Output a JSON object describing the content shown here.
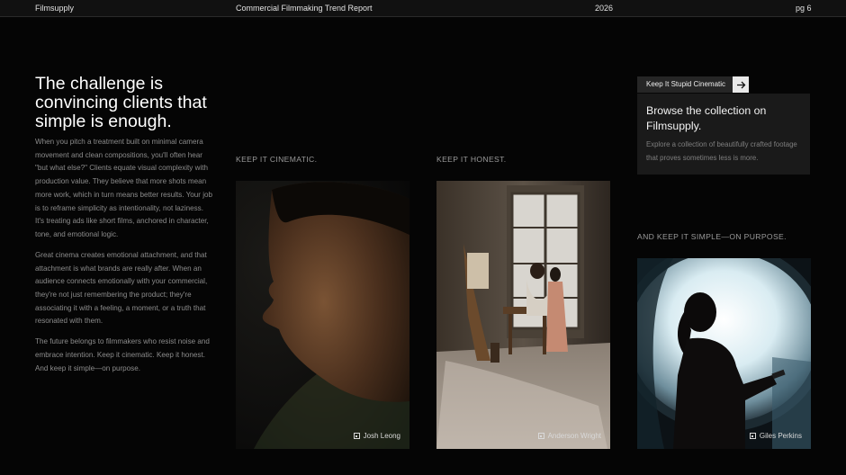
{
  "header": {
    "brand": "Filmsupply",
    "report_title": "Commercial Filmmaking Trend Report",
    "year": "2026",
    "page": "pg 6"
  },
  "intro": {
    "headline": "The challenge is convincing clients that simple is enough.",
    "paragraphs": [
      "When you pitch a treatment built on minimal camera movement and clean compositions, you'll often hear \"but what else?\" Clients equate visual complexity with production value. They believe that more shots mean more work, which in turn means better results. Your job is to reframe simplicity as intentionality, not laziness. It's treating ads like short films, anchored in character, tone, and emotional logic.",
      "Great cinema creates emotional attachment, and that attachment is what brands are really after. When an audience connects emotionally with your commercial, they're not just remembering the product; they're associating it with a feeling, a moment, or a truth that resonated with them.",
      "The future belongs to filmmakers who resist noise and embrace intention. Keep it cinematic. Keep it honest. And keep it simple—on purpose."
    ]
  },
  "columns": [
    {
      "label": "KEEP IT CINEMATIC.",
      "credit": "Josh Leong",
      "icon": "photo-credit-icon"
    },
    {
      "label": "KEEP IT HONEST.",
      "credit": "Anderson Wright",
      "icon": "photo-credit-icon"
    },
    {
      "label": "AND KEEP IT SIMPLE—ON PURPOSE.",
      "credit": "Giles Perkins",
      "icon": "photo-credit-icon"
    }
  ],
  "promo": {
    "tag": "Keep It Stupid Cinematic",
    "arrow_icon": "arrow-right-icon",
    "title": "Browse the collection on Filmsupply.",
    "description": "Explore a collection of beautifully crafted footage that proves sometimes less is more."
  },
  "colors": {
    "background": "#050505",
    "topbar": "#111111",
    "card": "#1a1a1a",
    "arrow_button": "#e9e9e9"
  }
}
